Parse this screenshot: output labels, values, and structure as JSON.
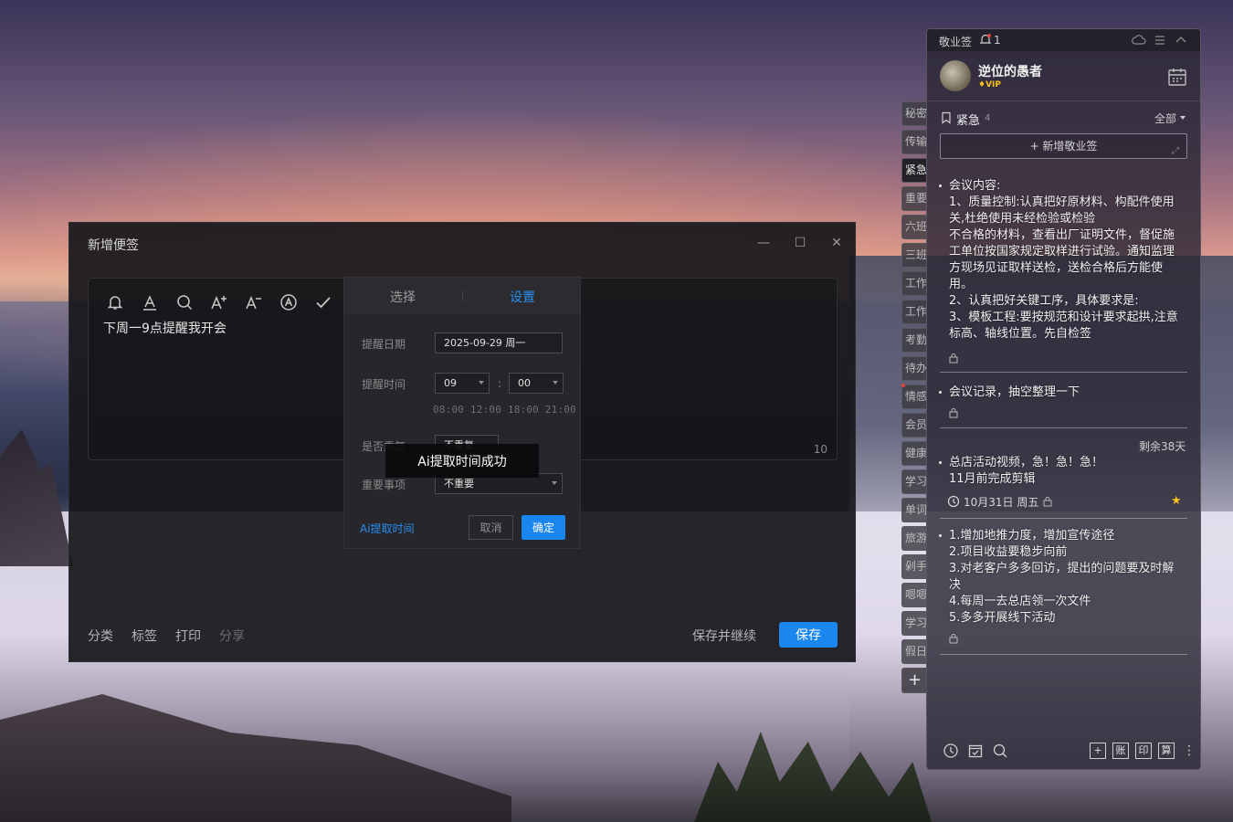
{
  "dialog": {
    "title": "新增便签",
    "editor_text": "下周一9点提醒我开会",
    "char_count": "10",
    "bottom_links": [
      "分类",
      "标签",
      "打印",
      "分享"
    ],
    "save_continue": "保存并继续",
    "save": "保存",
    "toolbar_icons": [
      "bell-icon",
      "text-color-icon",
      "search-icon",
      "font-increase-icon",
      "font-decrease-icon",
      "ai-icon",
      "check-icon"
    ]
  },
  "popover": {
    "tabs": [
      "选择",
      "设置"
    ],
    "active_tab": "设置",
    "date_label": "提醒日期",
    "date_value": "2025-09-29 周一",
    "time_label": "提醒时间",
    "hour": "09",
    "minute": "00",
    "colon": ":",
    "quick_times": "08:00 12:00 18:00 21:00",
    "repeat_label": "是否重复",
    "repeat_value": "不重复",
    "important_label": "重要事项",
    "important_value": "不重要",
    "ai_link": "Ai提取时间",
    "cancel": "取消",
    "ok": "确定"
  },
  "toast": "Ai提取时间成功",
  "side_tabs": [
    "秘密",
    "传输",
    "紧急",
    "重要",
    "六班",
    "三班",
    "工作",
    "工作",
    "考勤",
    "待办",
    "情感",
    "会员",
    "健康",
    "学习",
    "单词",
    "旅游",
    "剁手",
    "嗯嗯",
    "学习",
    "假日"
  ],
  "side_active": 2,
  "side_add": "+",
  "panel": {
    "app_name": "敬业签",
    "notif_count": "1",
    "username": "逆位的愚者",
    "vip": "VIP",
    "category": "紧急",
    "category_count": "4",
    "filter": "全部",
    "add_note": "+ 新增敬业签",
    "notes": [
      {
        "lines": [
          "会议内容:",
          "1、质量控制:认真把好原材料、构配件使用",
          "关,杜绝使用未经检验或检验",
          "不合格的材料，查看出厂证明文件，督促施",
          "工单位按国家规定取样进行试验。通知监理",
          "方现场见证取样送检，送检合格后方能使",
          "用。",
          "2、认真把好关键工序，具体要求是:",
          "3、模板工程:要按规范和设计要求起拱,注意",
          "标高、轴线位置。先自检签"
        ]
      },
      {
        "lines": [
          "会议记录，抽空整理一下"
        ]
      },
      {
        "remaining": "剩余38天",
        "lines": [
          "总店活动视频，急！急！急！",
          "11月前完成剪辑"
        ],
        "due": "10月31日 周五"
      },
      {
        "lines": [
          "1.增加地推力度，增加宣传途径",
          "2.项目收益要稳步向前",
          "3.对老客户多多回访，提出的问题要及时解",
          "决",
          "4.每周一去总店领一次文件",
          "5.多多开展线下活动"
        ]
      }
    ],
    "footer_boxes": [
      "+",
      "账",
      "印",
      "算"
    ],
    "footer_more": "⋮"
  }
}
